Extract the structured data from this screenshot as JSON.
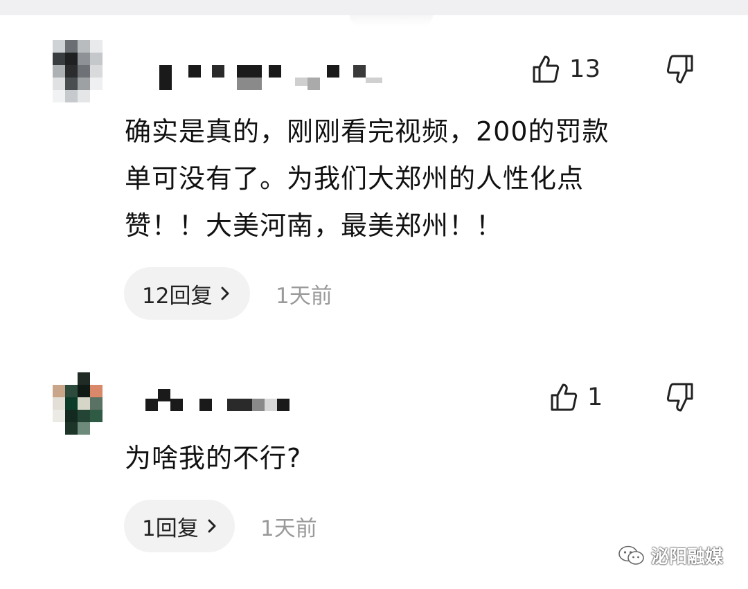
{
  "comments": [
    {
      "text": "确实是真的，刚刚看完视频，200的罚款\n单可没有了。为我们大郑州的人性化点\n赞！！大美河南，最美郑州！！",
      "likes": "13",
      "reply_label": "12回复",
      "time": "1天前"
    },
    {
      "text": "为啥我的不行?",
      "likes": "1",
      "reply_label": "1回复",
      "time": "1天前"
    }
  ],
  "icons": {
    "like": "thumbs-up-icon",
    "dislike": "thumbs-down-icon",
    "reply_arrow": "chevron-right-icon",
    "watermark": "wechat-icon"
  },
  "watermark": {
    "text": "泌阳融媒"
  },
  "colors": {
    "text": "#111111",
    "muted": "#9a9a9a",
    "chip_bg": "#f2f2f3"
  }
}
